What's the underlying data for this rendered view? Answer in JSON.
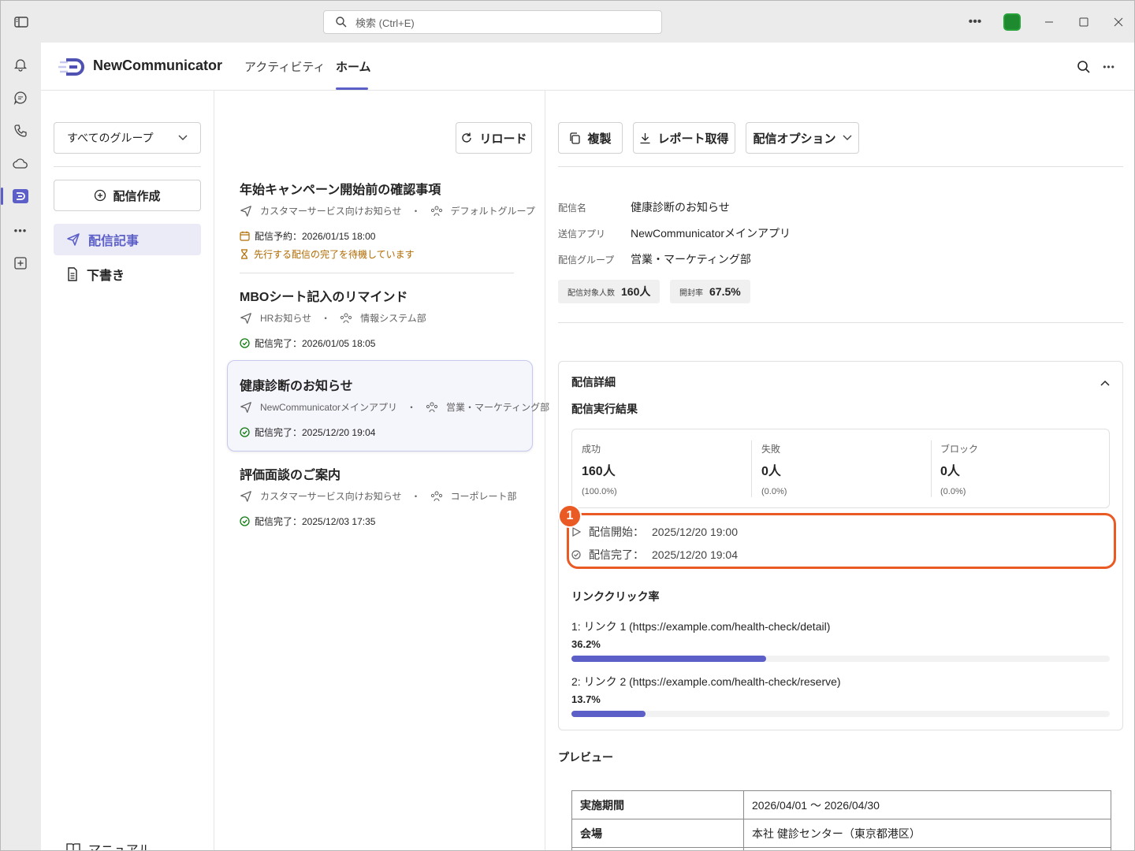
{
  "titlebar": {
    "search_placeholder": "検索 (Ctrl+E)"
  },
  "app": {
    "name": "NewCommunicator",
    "tabs": [
      "アクティビティ",
      "ホーム"
    ],
    "active_tab": "ホーム"
  },
  "sidebar": {
    "group_dropdown": "すべてのグループ",
    "create_button": "配信作成",
    "items": [
      {
        "label": "配信記事",
        "active": true
      },
      {
        "label": "下書き",
        "active": false
      }
    ],
    "manual": "マニュアル"
  },
  "list": {
    "reload_button": "リロード",
    "messages": [
      {
        "title": "年始キャンペーン開始前の確認事項",
        "app": "カスタマーサービス向けお知らせ",
        "group": "デフォルトグループ",
        "status": "配信予約：2026/01/15 18:00",
        "warning": "先行する配信の完了を待機しています"
      },
      {
        "title": "MBOシート記入のリマインド",
        "app": "HRお知らせ",
        "group": "情報システム部",
        "status": "配信完了：2026/01/05 18:05"
      },
      {
        "title": "健康診断のお知らせ",
        "app": "NewCommunicatorメインアプリ",
        "group": "営業・マーケティング部",
        "status": "配信完了：2025/12/20 19:04"
      },
      {
        "title": "評価面談のご案内",
        "app": "カスタマーサービス向けお知らせ",
        "group": "コーポレート部",
        "status": "配信完了：2025/12/03 17:35"
      }
    ],
    "separator": "・"
  },
  "detail": {
    "toolbar": {
      "copy": "複製",
      "report": "レポート取得",
      "options": "配信オプション"
    },
    "fields": [
      {
        "key": "配信名",
        "value": "健康診断のお知らせ"
      },
      {
        "key": "送信アプリ",
        "value": "NewCommunicatorメインアプリ"
      },
      {
        "key": "配信グループ",
        "value": "営業・マーケティング部"
      }
    ],
    "pills": [
      {
        "key": "配信対象人数",
        "value": "160人"
      },
      {
        "key": "開封率",
        "value": "67.5%"
      }
    ],
    "card_title": "配信詳細",
    "result_title": "配信実行結果",
    "stats": [
      {
        "label": "成功",
        "value": "160人",
        "pct": "(100.0%)"
      },
      {
        "label": "失敗",
        "value": "0人",
        "pct": "(0.0%)"
      },
      {
        "label": "ブロック",
        "value": "0人",
        "pct": "(0.0%)"
      }
    ],
    "timeline": [
      {
        "label": "配信開始：",
        "value": "2025/12/20 19:00"
      },
      {
        "label": "配信完了：",
        "value": "2025/12/20 19:04"
      }
    ],
    "annotation_number": "1",
    "annotation_color": "#ea5a25",
    "link_section_title": "リンククリック率",
    "links": [
      {
        "label": "1: リンク 1 (https://example.com/health-check/detail)",
        "pct_text": "36.2%",
        "pct": 0.362
      },
      {
        "label": "2: リンク 2 (https://example.com/health-check/reserve)",
        "pct_text": "13.7%",
        "pct": 0.137
      }
    ],
    "preview_title": "プレビュー",
    "preview_table": [
      {
        "key": "実施期間",
        "value": "2026/04/01 〜 2026/04/30"
      },
      {
        "key": "会場",
        "value": "本社 健診センター（東京都港区）"
      }
    ]
  },
  "colors": {
    "accent": "#5b5fc7",
    "warning": "#b06a00",
    "success": "#107c10"
  }
}
